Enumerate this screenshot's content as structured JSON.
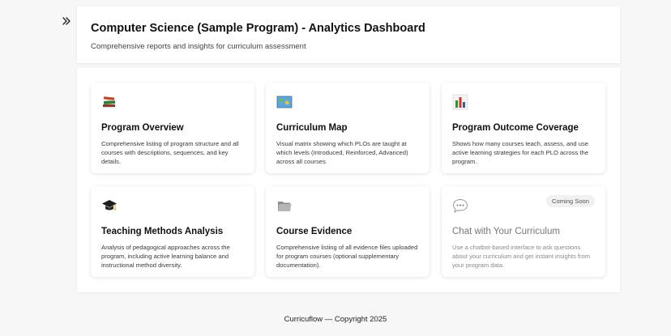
{
  "sidebar": {
    "toggle_icon": "double-chevron-right-icon"
  },
  "header": {
    "title": "Computer Science (Sample Program) - Analytics Dashboard",
    "subtitle": "Comprehensive reports and insights for curriculum assessment"
  },
  "cards": [
    {
      "icon": "books-icon",
      "title": "Program Overview",
      "description": "Comprehensive listing of program structure and all courses with descriptions, sequences, and key details."
    },
    {
      "icon": "map-icon",
      "title": "Curriculum Map",
      "description": "Visual matrix showing which PLOs are taught at which levels (Introduced, Reinforced, Advanced) across all courses."
    },
    {
      "icon": "bar-chart-icon",
      "title": "Program Outcome Coverage",
      "description": "Shows how many courses teach, assess, and use active learning strategies for each PLO across the program."
    },
    {
      "icon": "graduation-cap-icon",
      "title": "Teaching Methods Analysis",
      "description": "Analysis of pedagogical approaches across the program, including active learning balance and instructional method diversity."
    },
    {
      "icon": "folder-icon",
      "title": "Course Evidence",
      "description": "Comprehensive listing of all evidence files uploaded for program courses (optional supplementary documentation)."
    },
    {
      "icon": "speech-bubble-icon",
      "title": "Chat with Your Curriculum",
      "description": "Use a chatbot-based interface to ask questions about your curriculum and get instant insights from your program data.",
      "badge": "Coming Soon"
    }
  ],
  "footer": {
    "text": "Curricuflow — Copyright 2025"
  }
}
